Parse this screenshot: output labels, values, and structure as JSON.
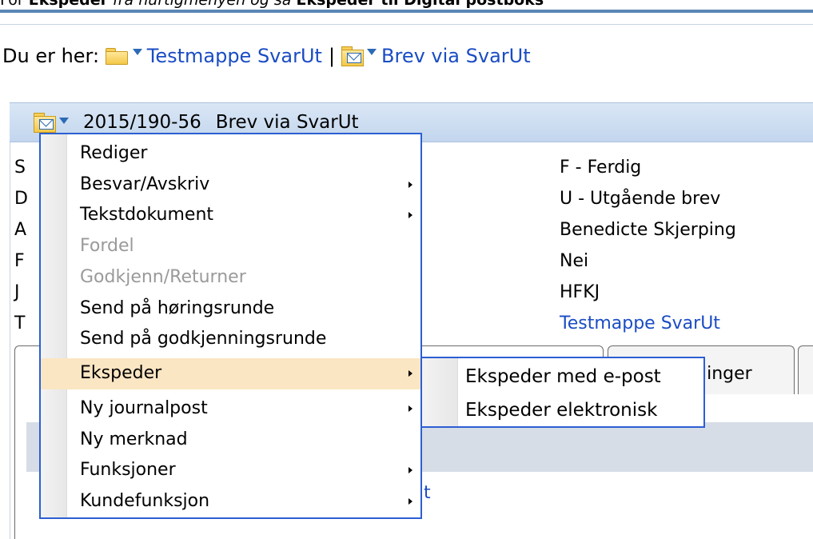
{
  "caption": {
    "prefix": "For ",
    "bold1": "Ekspeder",
    "middle": " fra hurtigmenyen og så ",
    "bold2": "Ekspeder",
    "bold3": " til Digital postboks"
  },
  "breadcrumb": {
    "label": "Du er her:",
    "items": [
      "Testmappe SvarUt",
      "Brev via SvarUt"
    ],
    "separator": "|"
  },
  "record": {
    "number": "2015/190-56",
    "title": "Brev via SvarUt"
  },
  "left_labels": [
    "S",
    "D",
    "A",
    "F",
    "J",
    "T"
  ],
  "fields": [
    "F - Ferdig",
    "U - Utgående brev",
    "Benedicte Skjerping",
    "Nei",
    "HFKJ",
    "Testmappe SvarUt"
  ],
  "tabs": [
    "dlinger"
  ],
  "content_fragment": "t",
  "context_menu": {
    "items": [
      {
        "label": "Rediger",
        "disabled": false,
        "submenu": false
      },
      {
        "label": "Besvar/Avskriv",
        "disabled": false,
        "submenu": true
      },
      {
        "label": "Tekstdokument",
        "disabled": false,
        "submenu": true
      },
      {
        "label": "Fordel",
        "disabled": true,
        "submenu": false
      },
      {
        "label": "Godkjenn/Returner",
        "disabled": true,
        "submenu": false
      },
      {
        "label": "Send på høringsrunde",
        "disabled": false,
        "submenu": false
      },
      {
        "label": "Send på godkjenningsrunde",
        "disabled": false,
        "submenu": false
      },
      {
        "label": "Ekspeder",
        "disabled": false,
        "submenu": true,
        "highlighted": true
      },
      {
        "label": "Ny journalpost",
        "disabled": false,
        "submenu": true
      },
      {
        "label": "Ny merknad",
        "disabled": false,
        "submenu": false
      },
      {
        "label": "Funksjoner",
        "disabled": false,
        "submenu": true
      },
      {
        "label": "Kundefunksjon",
        "disabled": false,
        "submenu": true
      }
    ]
  },
  "submenu": {
    "items": [
      "Ekspeder med e-post",
      "Ekspeder elektronisk"
    ]
  },
  "colors": {
    "link": "#1a4cc4",
    "menu_border": "#2c5fd3",
    "highlight": "#fbe6c3",
    "marker": "#f6ff00"
  }
}
